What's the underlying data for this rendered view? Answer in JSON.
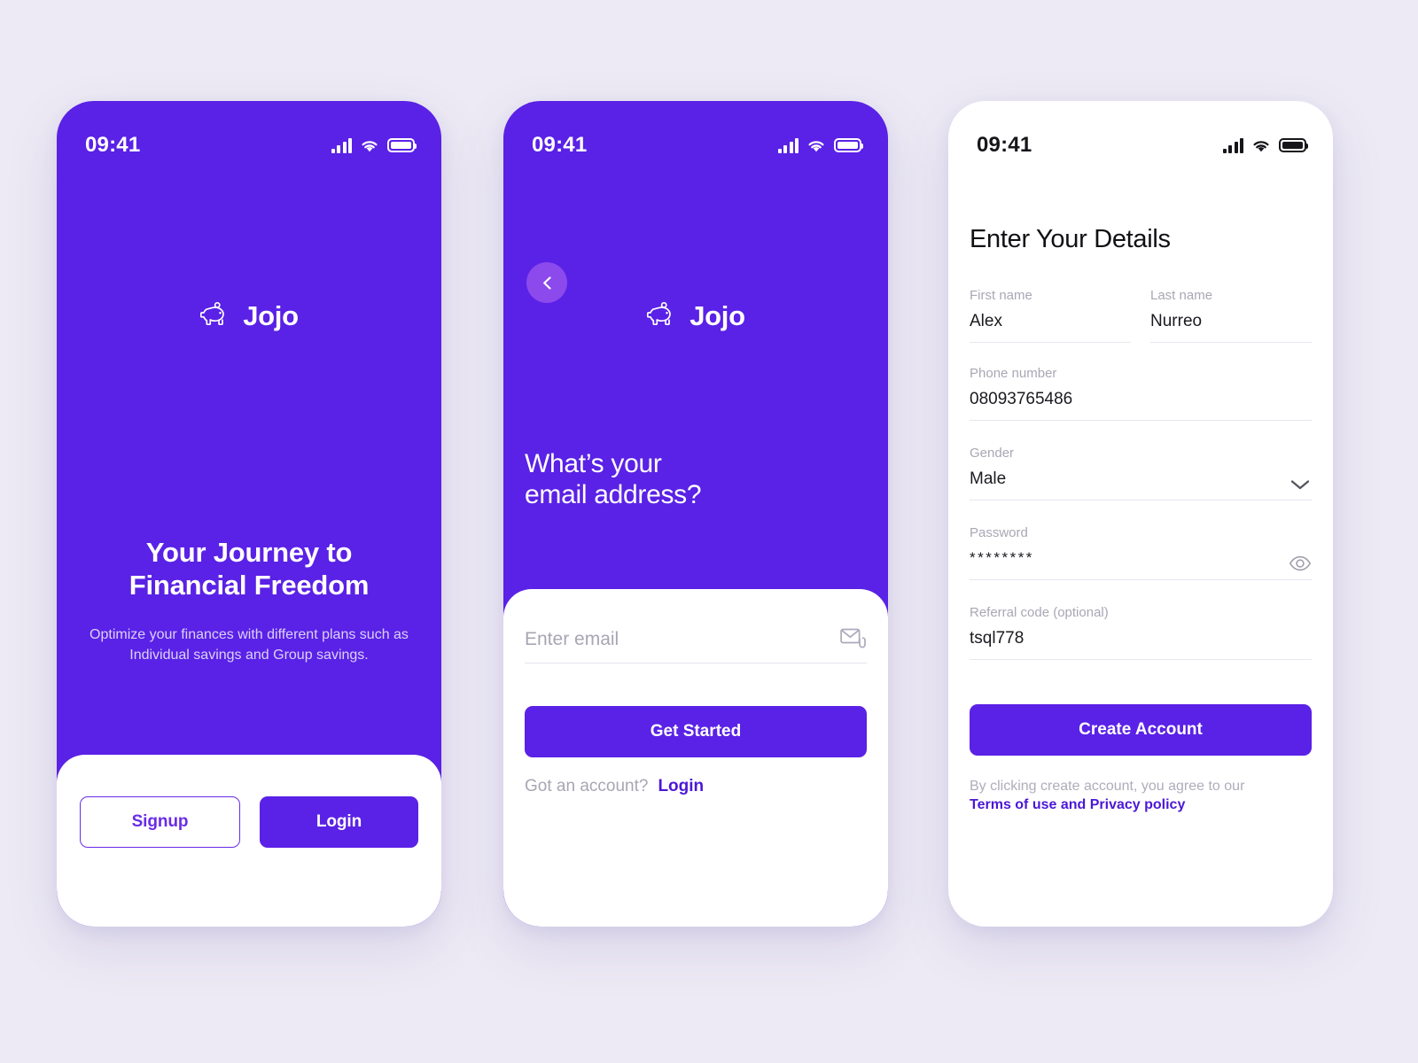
{
  "colors": {
    "brand_purple": "#5A21E6",
    "brand_purple_link": "#4B17D6",
    "back_button_purple": "#8C49EC",
    "page_background": "#EDEAF5",
    "muted_text": "#A8A6B4",
    "body_text": "#1A1A20"
  },
  "screen_onboarding": {
    "status": {
      "time": "09:41",
      "signal_icon": "signal-bars-icon",
      "wifi_icon": "wifi-icon",
      "battery_icon": "battery-icon"
    },
    "brand": {
      "logo_icon": "piggy-bank-icon",
      "name": "Jojo"
    },
    "hero": {
      "title_line1": "Your Journey to",
      "title_line2": "Financial Freedom",
      "subtitle": "Optimize your finances with different plans such as Individual savings and Group savings."
    },
    "actions": {
      "signup_label": "Signup",
      "login_label": "Login"
    }
  },
  "screen_email": {
    "status": {
      "time": "09:41",
      "signal_icon": "signal-bars-icon",
      "wifi_icon": "wifi-icon",
      "battery_icon": "battery-icon"
    },
    "back_icon": "chevron-left-icon",
    "brand": {
      "logo_icon": "piggy-bank-icon",
      "name": "Jojo"
    },
    "question_line1": "What’s your",
    "question_line2": "email address?",
    "email_field": {
      "placeholder": "Enter email",
      "value": "",
      "trailing_icon": "mail-attachment-icon"
    },
    "cta_label": "Get Started",
    "footer": {
      "prompt": "Got an account?",
      "link_label": "Login"
    }
  },
  "screen_details": {
    "status": {
      "time": "09:41",
      "signal_icon": "signal-bars-icon",
      "wifi_icon": "wifi-icon",
      "battery_icon": "battery-icon"
    },
    "title": "Enter Your Details",
    "fields": [
      {
        "label": "First name",
        "value": "Alex"
      },
      {
        "label": "Last name",
        "value": "Nurreo"
      },
      {
        "label": "Phone number",
        "value": "08093765486"
      },
      {
        "label": "Gender",
        "value": "Male",
        "trailing_icon": "chevron-down-icon"
      },
      {
        "label": "Password",
        "value": "********",
        "trailing_icon": "eye-icon"
      },
      {
        "label": "Referral code (optional)",
        "value": "tsql778"
      }
    ],
    "cta_label": "Create Account",
    "legal_text": "By clicking create account, you agree to our",
    "legal_link": "Terms of use and Privacy policy"
  }
}
